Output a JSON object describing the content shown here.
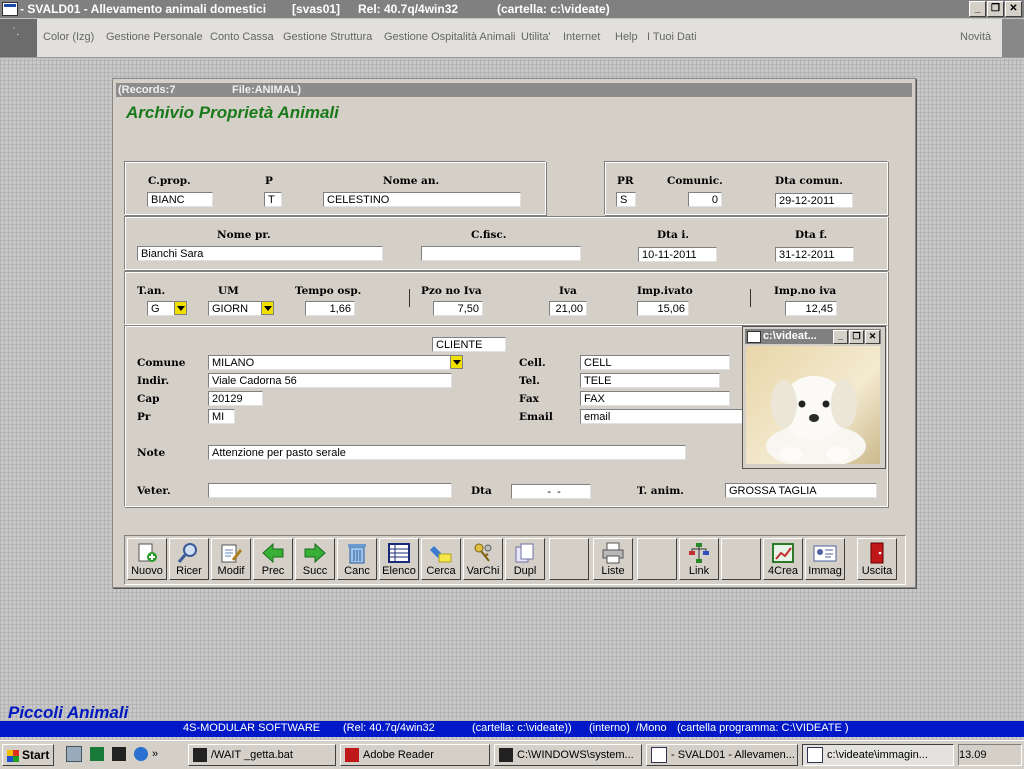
{
  "window": {
    "app": "- SVALD01 - Allevamento animali domestici",
    "code": "[svas01]",
    "rel": "Rel: 40.7q/4win32",
    "folder": "(cartella: c:\\videate)",
    "btn_min": "_",
    "btn_restore": "❐",
    "btn_close": "✕"
  },
  "menu": {
    "ctrl_glyph": "˙.",
    "items": [
      "Color (Izg)",
      "Gestione Personale",
      "Conto Cassa",
      "Gestione Struttura",
      "Gestione Ospitalità Animali",
      "Utilita'",
      "Internet",
      "Help",
      "I Tuoi Dati"
    ],
    "novita": "Novità"
  },
  "form": {
    "records": "(Records:7",
    "file": "File:ANIMAL)",
    "title": "Archivio Proprietà Animali",
    "labels": {
      "cprop": "C.prop.",
      "p": "P",
      "nome_an": "Nome an.",
      "pr": "PR",
      "comunic": "Comunic.",
      "dta_comun": "Dta comun.",
      "nome_pr": "Nome pr.",
      "cfisc": "C.fisc.",
      "dta_i": "Dta i.",
      "dta_f": "Dta f.",
      "tan": "T.an.",
      "um": "UM",
      "tempo_osp": "Tempo osp.",
      "pzo_no_iva": "Pzo no Iva",
      "iva": "Iva",
      "imp_ivato": "Imp.ivato",
      "imp_no_iva": "Imp.no iva",
      "comune": "Comune",
      "indir": "Indir.",
      "cap": "Cap",
      "pr2": "Pr",
      "cell": "Cell.",
      "tel": "Tel.",
      "fax": "Fax",
      "email": "Email",
      "note": "Note",
      "veter": "Veter.",
      "dta": "Dta",
      "t_anim": "T. anim."
    },
    "values": {
      "cprop": "BIANC",
      "p": "T",
      "nome_an": "CELESTINO",
      "pr": "S",
      "comunic": "0",
      "dta_comun": "29-12-2011",
      "nome_pr": "Bianchi Sara",
      "cfisc": "",
      "dta_i": "10-11-2011",
      "dta_f": "31-12-2011",
      "tan": "G",
      "um": "GIORN",
      "tempo_osp": "1,66",
      "pzo_no_iva": "7,50",
      "iva": "21,00",
      "imp_ivato": "15,06",
      "imp_no_iva": "12,45",
      "cliente": "CLIENTE",
      "comune": "MILANO",
      "indir": "Viale Cadorna 56",
      "cap": "20129",
      "pr2": "MI",
      "cell": "CELL",
      "tel": "TELE",
      "fax": "FAX",
      "email": "email",
      "note": "Attenzione per pasto serale",
      "veter": "",
      "dta": "  -  -",
      "t_anim": "GROSSA TAGLIA"
    }
  },
  "toolbar": {
    "buttons": [
      "Nuovo",
      "Ricer",
      "Modif",
      "Prec",
      "Succ",
      "Canc",
      "Elenco",
      "Cerca",
      "VarChi",
      "Dupl",
      "",
      "Liste",
      "",
      "Link",
      "",
      "4Crea",
      "Immag",
      "Uscita"
    ]
  },
  "image_window": {
    "title": "c:\\videat..."
  },
  "footer": {
    "brand": "Piccoli Animali",
    "status": [
      "4S-MODULAR SOFTWARE",
      "(Rel: 40.7q/4win32",
      "(cartella: c:\\videate))",
      "(interno)",
      "/Mono",
      "(cartella programma: C:\\VIDEATE )"
    ]
  },
  "taskbar": {
    "start": "Start",
    "quick": "»",
    "items": [
      "/WAIT _getta.bat",
      "Adobe Reader",
      "C:\\WINDOWS\\system...",
      "- SVALD01 - Allevamen...",
      "c:\\videate\\immagin..."
    ],
    "clock": "13.09"
  },
  "colors": {
    "title_green": "#1a7a1a",
    "status_blue": "#0018c8",
    "brand_blue": "#0018c0",
    "dropdown_yellow": "#f0e000"
  }
}
